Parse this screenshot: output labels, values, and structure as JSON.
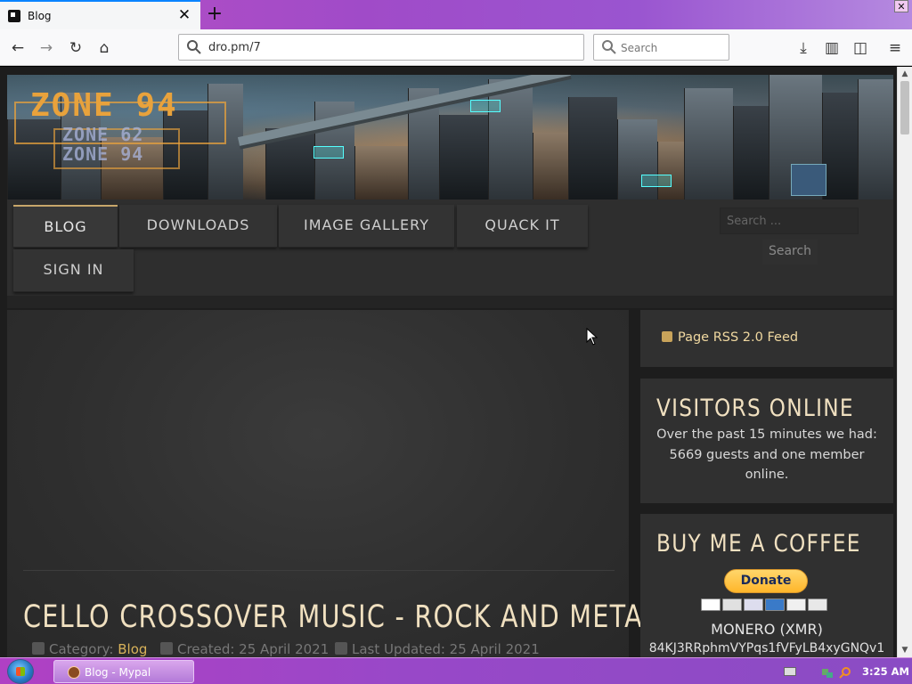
{
  "browser": {
    "tab_title": "Blog",
    "url": "dro.pm/7",
    "search_placeholder": "Search",
    "accent": "#0a84ff"
  },
  "site": {
    "logo": "ZONE 94",
    "logo_sub_1": "ZONE 62",
    "logo_sub_2": "ZONE 94",
    "menu": [
      {
        "label": "BLOG",
        "active": true
      },
      {
        "label": "DOWNLOADS",
        "active": false
      },
      {
        "label": "IMAGE GALLERY",
        "active": false
      },
      {
        "label": "QUACK IT",
        "active": false
      },
      {
        "label": "SIGN IN",
        "active": false
      }
    ],
    "search_placeholder": "Search ...",
    "search_button": "Search",
    "accent_gold": "#d8b25a"
  },
  "post": {
    "title": "CELLO CROSSOVER MUSIC - ROCK AND METAL",
    "category_label": "Category:",
    "category": "Blog",
    "created": "Created: 25 April 2021",
    "updated": "Last Updated: 25 April 2021"
  },
  "sidebar": {
    "rss": "Page RSS 2.0 Feed",
    "visitors_title": "VISITORS ONLINE",
    "visitors_text": "Over the past 15 minutes we had: 5669 guests and one member online.",
    "coffee_title": "BUY ME A COFFEE",
    "donate": "Donate",
    "monero": "MONERO (XMR)",
    "address": "84KJ3RRphmVYPqs1fVFyLB4xyGNQv1"
  },
  "taskbar": {
    "task_label": "Blog - Mypal",
    "clock": "3:25 AM"
  }
}
